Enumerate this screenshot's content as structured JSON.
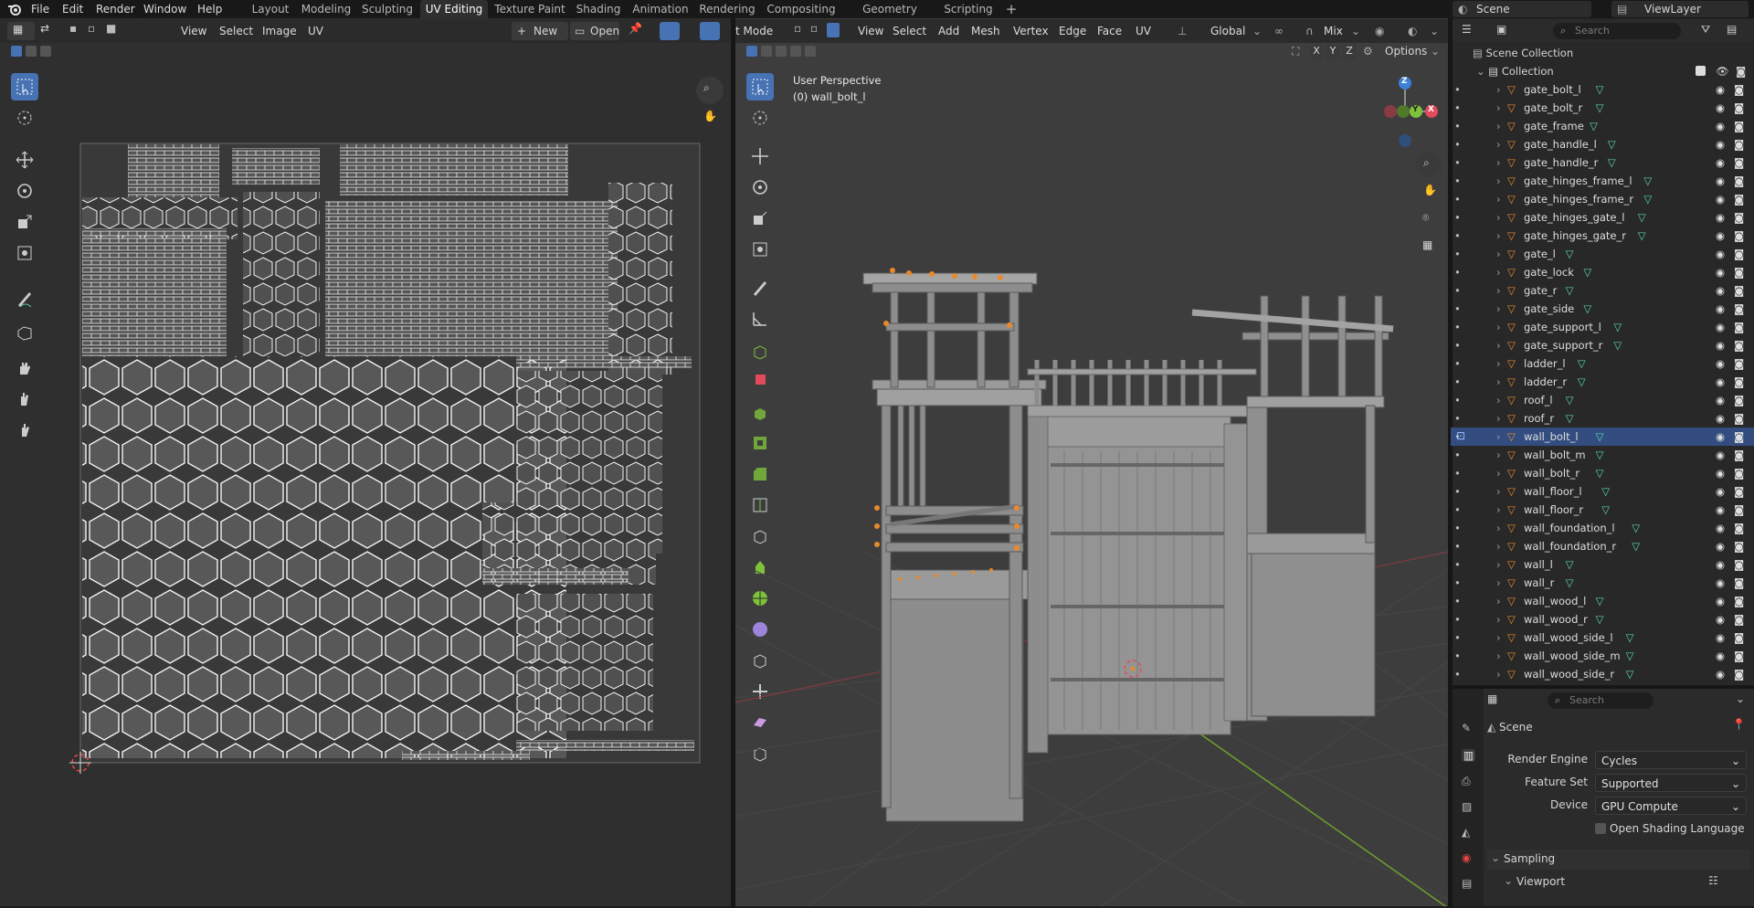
{
  "menubar": {
    "file": "File",
    "edit": "Edit",
    "render": "Render",
    "window": "Window",
    "help": "Help"
  },
  "workspaces": [
    "Layout",
    "Modeling",
    "Sculpting",
    "UV Editing",
    "Texture Paint",
    "Shading",
    "Animation",
    "Rendering",
    "Compositing",
    "Geometry Nodes",
    "Scripting"
  ],
  "workspace_add": "+",
  "scene_selector": {
    "value": "Scene"
  },
  "view_layer": {
    "value": "ViewLayer"
  },
  "uv_editor": {
    "menus": [
      "View",
      "Select",
      "Image",
      "UV"
    ],
    "new_label": "New",
    "open_label": "Open"
  },
  "viewport": {
    "mode_label": "t Mode",
    "menus": [
      "View",
      "Select",
      "Add",
      "Mesh",
      "Vertex",
      "Edge",
      "Face",
      "UV"
    ],
    "transform_orientation": "Global",
    "proportional": "Mix",
    "options_label": "Options",
    "axis_x": "X",
    "axis_y": "Y",
    "axis_z": "Z",
    "overlay_title": "User Perspective",
    "overlay_object": "(0) wall_bolt_l",
    "gizmo_x": "X",
    "gizmo_y": "Y",
    "gizmo_z": "Z"
  },
  "outliner": {
    "search_placeholder": "Search",
    "scene_collection": "Scene Collection",
    "collection": "Collection",
    "items": [
      "gate_bolt_l",
      "gate_bolt_r",
      "gate_frame",
      "gate_handle_l",
      "gate_handle_r",
      "gate_hinges_frame_l",
      "gate_hinges_frame_r",
      "gate_hinges_gate_l",
      "gate_hinges_gate_r",
      "gate_l",
      "gate_lock",
      "gate_r",
      "gate_side",
      "gate_support_l",
      "gate_support_r",
      "ladder_l",
      "ladder_r",
      "roof_l",
      "roof_r",
      "wall_bolt_l",
      "wall_bolt_m",
      "wall_bolt_r",
      "wall_floor_l",
      "wall_floor_r",
      "wall_foundation_l",
      "wall_foundation_r",
      "wall_l",
      "wall_r",
      "wall_wood_l",
      "wall_wood_r",
      "wall_wood_side_l",
      "wall_wood_side_m",
      "wall_wood_side_r"
    ],
    "selected_item": "wall_bolt_l"
  },
  "properties": {
    "search_placeholder": "Search",
    "context": "Scene",
    "render_engine_label": "Render Engine",
    "render_engine_value": "Cycles",
    "feature_set_label": "Feature Set",
    "feature_set_value": "Supported",
    "device_label": "Device",
    "device_value": "GPU Compute",
    "osl_label": "Open Shading Language",
    "sampling_label": "Sampling",
    "viewport_label": "Viewport"
  },
  "colors": {
    "accent": "#4772b3",
    "axis_x": "#e24b5b",
    "axis_y": "#7ec13b",
    "axis_z": "#3b7fd6",
    "object_orange": "#e88a2c"
  }
}
